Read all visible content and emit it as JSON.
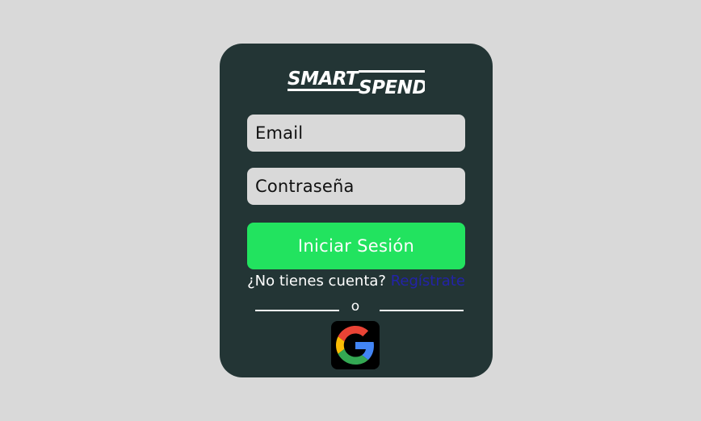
{
  "logo": {
    "text": "SMARTSPEND"
  },
  "form": {
    "email_placeholder": "Email",
    "password_placeholder": "Contraseña",
    "login_button": "Iniciar Sesión"
  },
  "signup": {
    "prompt": "¿No tienes cuenta?",
    "link": "Regístrate"
  },
  "divider": {
    "text": "o"
  },
  "social": {
    "google_icon": "google-icon"
  },
  "colors": {
    "background": "#d9d9d9",
    "card": "#233535",
    "primary_button": "#22e35f",
    "link": "#2323a8"
  }
}
